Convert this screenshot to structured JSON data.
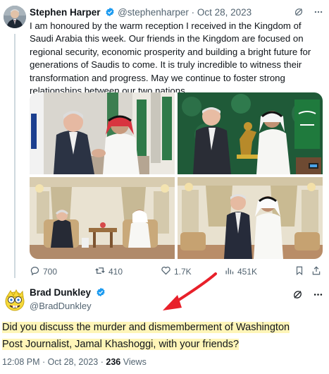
{
  "original_tweet": {
    "display_name": "Stephen Harper",
    "handle": "@stephenharper",
    "separator": "·",
    "date": "Oct 28, 2023",
    "text": "I am honoured by the warm reception I received in the Kingdom of Saudi Arabia this week. Our friends in the Kingdom are focused on regional security, economic prosperity and building a bright future for generations of Saudis to come. It is truly incredible to witness their transformation and progress. May we continue to foster strong relationships between our two nations.",
    "photos": [
      "photo-handshake",
      "photo-statue-gift",
      "photo-seated-meeting",
      "photo-standing-portrait"
    ],
    "stats": {
      "replies": "700",
      "reposts": "410",
      "likes": "1.7K",
      "views": "451K"
    },
    "icons": [
      "grok-icon",
      "more-icon",
      "verified-badge-icon",
      "reply-icon",
      "repost-icon",
      "like-icon",
      "views-icon",
      "bookmark-icon",
      "share-icon"
    ]
  },
  "reply_tweet": {
    "display_name": "Brad Dunkley",
    "handle": "@BradDunkley",
    "text": "Did you discuss the murder and dismemberment of Washington Post Journalist, Jamal Khashoggi, with your friends?",
    "time": "12:08 PM",
    "separator": "·",
    "date": "Oct 28, 2023",
    "separator2": "·",
    "views_count": "236",
    "views_label": "Views"
  },
  "colors": {
    "verified": "#1d9bf0",
    "highlight": "#fff5b8",
    "arrow": "#e8202a",
    "muted": "#536471",
    "thread_line": "#cfd9de"
  }
}
